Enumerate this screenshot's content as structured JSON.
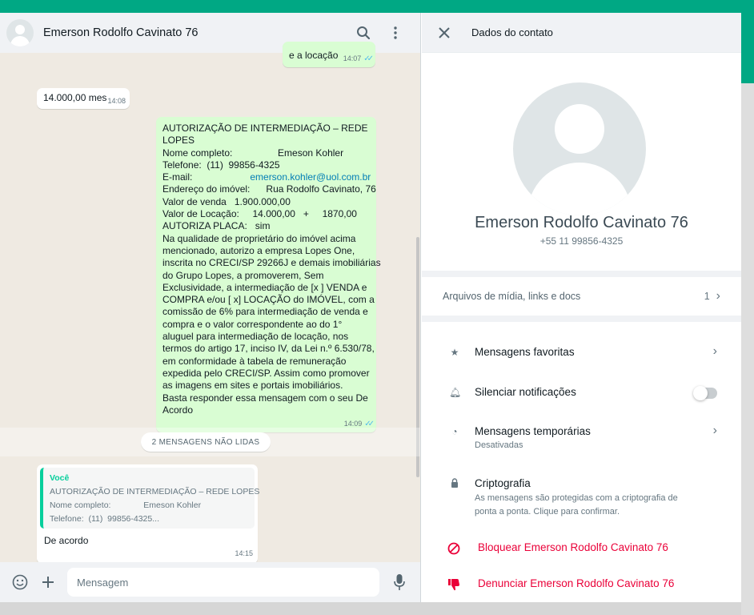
{
  "chat": {
    "contact_name": "Emerson Rodolfo Cavinato 76",
    "messages": [
      {
        "text": "e a locação",
        "time": "14:07"
      },
      {
        "text": "14.000,00 mes",
        "time": "14:08"
      },
      {
        "lines": [
          "AUTORIZAÇÃO DE INTERMEDIAÇÃO – REDE",
          "LOPES",
          "Nome completo:                 Emeson Kohler",
          "Telefone:  (11)  99856-4325",
          "Endereço do imóvel:      Rua Rodolfo Cavinato, 76",
          "Valor de venda   1.900.000,00",
          "Valor de Locação:     14.000,00   +     1870,00",
          "AUTORIZA PLACA:   sim",
          "Na qualidade de proprietário do imóvel acima",
          "mencionado, autorizo a empresa Lopes One,",
          "inscrita no CRECI/SP 29266J e demais imobiliárias",
          "do Grupo Lopes, a promoverem, Sem",
          "Exclusividade, a intermediação de [x ] VENDA e",
          "COMPRA e/ou [ x] LOCAÇÃO do IMÓVEL, com a",
          "comissão de 6% para intermediação de venda e",
          "compra e o valor correspondente ao do 1°",
          "aluguel para intermediação de locação, nos",
          "termos do artigo 17, inciso IV, da Lei n.º 6.530/78,",
          "em conformidade à tabela de remuneração",
          "expedida pelo CRECI/SP. Assim como promover",
          "as imagens em sites e portais imobiliários.",
          "Basta responder essa mensagem com o seu De",
          "Acordo"
        ],
        "email_label": "E-mail:",
        "email": "emerson.kohler@uol.com.br",
        "time": "14:09"
      }
    ],
    "unread_label": "2 MENSAGENS NÃO LIDAS",
    "reply": {
      "quote_author": "Você",
      "quote_lines": [
        "AUTORIZAÇÃO DE INTERMEDIAÇÃO – REDE LOPES",
        "Nome completo:              Emeson Kohler",
        "Telefone:  (11)  99856-4325..."
      ],
      "text": "De acordo",
      "time": "14:15"
    },
    "composer_placeholder": "Mensagem"
  },
  "contact": {
    "header_title": "Dados do contato",
    "name": "Emerson Rodolfo Cavinato 76",
    "phone": "+55 11 99856-4325",
    "media_label": "Arquivos de mídia, links e docs",
    "media_count": "1",
    "settings": {
      "starred": "Mensagens favoritas",
      "mute": "Silenciar notificações",
      "disappearing": "Mensagens temporárias",
      "disappearing_sub": "Desativadas",
      "encryption": "Criptografia",
      "encryption_sub_1": "As mensagens são protegidas com a criptografia de",
      "encryption_sub_2": "ponta a ponta. Clique para confirmar.",
      "block": "Bloquear Emerson Rodolfo Cavinato 76",
      "report": "Denunciar Emerson Rodolfo Cavinato 76"
    }
  },
  "colors": {
    "accent": "#00a884",
    "outgoing_bubble": "#d9fdd3",
    "danger": "#ea0038",
    "read_ticks": "#53bdeb"
  }
}
